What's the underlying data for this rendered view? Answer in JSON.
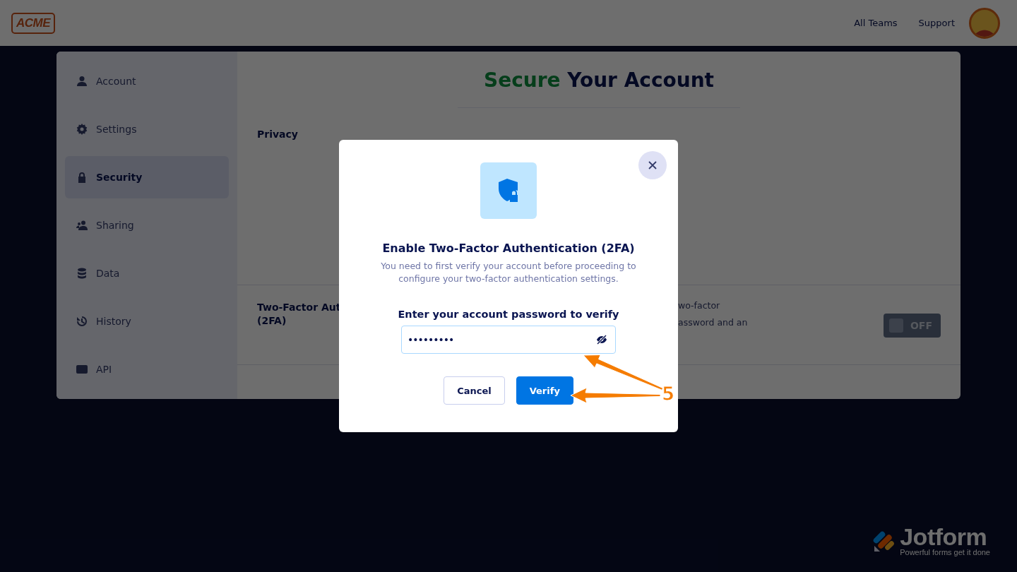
{
  "header": {
    "logo": "ACME",
    "links": [
      {
        "label": "All Teams"
      },
      {
        "label": "Support"
      }
    ]
  },
  "sidebar": {
    "items": [
      {
        "label": "Account",
        "selected": false
      },
      {
        "label": "Settings",
        "selected": false
      },
      {
        "label": "Security",
        "selected": true
      },
      {
        "label": "Sharing",
        "selected": false
      },
      {
        "label": "Data",
        "selected": false
      },
      {
        "label": "History",
        "selected": false
      },
      {
        "label": "API",
        "selected": false
      }
    ]
  },
  "main": {
    "title_accent": "Secure",
    "title_rest": "Your Account",
    "sections": [
      {
        "label_lines": [
          "Privacy"
        ]
      },
      {
        "label_lines": [
          "Two-Factor Aut",
          "(2FA)"
        ],
        "description_lines": [
          "wo-factor",
          "assword and an"
        ],
        "toggle": {
          "label": "OFF",
          "on": false
        }
      }
    ]
  },
  "modal": {
    "title": "Enable Two-Factor Authentication (2FA)",
    "description": "You need to first verify your account before proceeding to configure your two-factor authentication settings.",
    "field": {
      "label": "Enter your account password to verify",
      "value": "•••••••••"
    },
    "buttons": [
      {
        "label": "Cancel",
        "kind": "secondary"
      },
      {
        "label": "Verify",
        "kind": "primary"
      }
    ]
  },
  "annotation": {
    "number": "5"
  },
  "brand": {
    "name": "Jotform",
    "tagline": "Powerful forms get it done"
  }
}
